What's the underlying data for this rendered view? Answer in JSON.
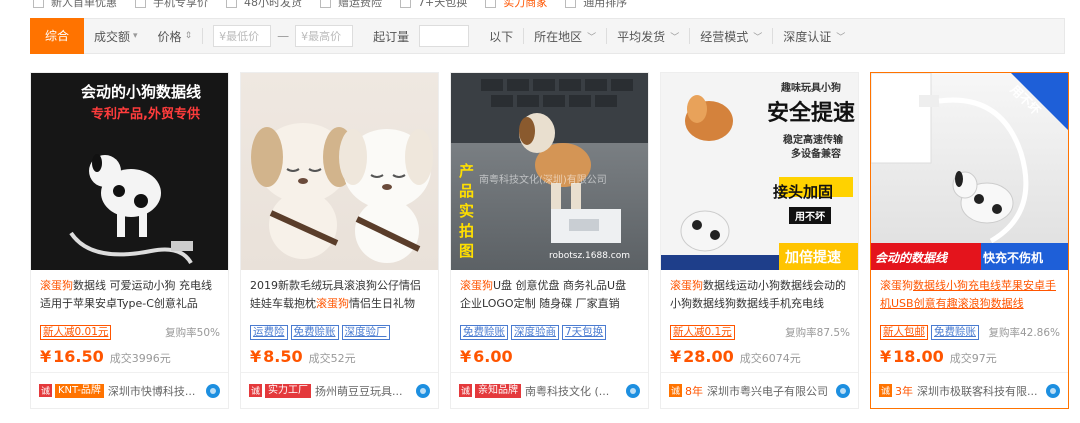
{
  "filters_top": [
    {
      "label": "新人首单优惠",
      "hot": false
    },
    {
      "label": "手机专享价",
      "hot": false
    },
    {
      "label": "48小时发货",
      "hot": false
    },
    {
      "label": "赠运费险",
      "hot": false
    },
    {
      "label": "7+天包换",
      "hot": false
    },
    {
      "label": "实力商家",
      "hot": true
    },
    {
      "label": "通用排序",
      "hot": false
    }
  ],
  "sortbar": {
    "active": "综合",
    "sales": "成交额",
    "price": "价格",
    "min_price_placeholder": "¥最低价",
    "sep": "—",
    "max_price_placeholder": "¥最高价",
    "moq": "起订量",
    "moq_suffix": "以下",
    "region": "所在地区",
    "ship": "平均发货",
    "mode": "经营模式",
    "auth": "深度认证"
  },
  "products": [
    {
      "image": {
        "headline": "会动的小狗数据线",
        "sub": "专利产品,外贸专供"
      },
      "title_kw": "滚蛋狗",
      "title_rest": "数据线 可爱运动小狗 充电线适用于苹果安卓Type-C创意礼品",
      "tags": [
        {
          "label": "新人减0.01元",
          "style": "red"
        }
      ],
      "repurchase": "复购率50%",
      "currency": "¥",
      "price": "16.50",
      "deal": "成交3996元",
      "badge_icon": "诚",
      "badge_label": "KNT-品牌",
      "badge_style": "orange",
      "year": "",
      "seller": "深圳市快博科技..."
    },
    {
      "image": {
        "headline": "",
        "sub": ""
      },
      "title_kw": "滚蛋狗",
      "title_pre": "2019新款毛绒玩具滚浪狗公仔情侣娃娃车载抱枕",
      "title_rest": "情侣生日礼物",
      "tags": [
        {
          "label": "运费险",
          "style": "blue"
        },
        {
          "label": "免费赊账",
          "style": "blue"
        },
        {
          "label": "深度验厂",
          "style": "blue"
        }
      ],
      "repurchase": "",
      "currency": "¥",
      "price": "8.50",
      "deal": "成交52元",
      "badge_icon": "诚",
      "badge_label": "实力工厂",
      "badge_style": "red",
      "year": "",
      "seller": "扬州萌豆豆玩具..."
    },
    {
      "image": {
        "headline": "南粤科技文化(深圳)有限公司",
        "sub": "robotsz.1688.com",
        "side": "产品实拍图"
      },
      "title_kw": "滚蛋狗",
      "title_rest": "U盘 创意优盘 商务礼品U盘 企业LOGO定制 随身碟 厂家直销",
      "tags": [
        {
          "label": "免费赊账",
          "style": "blue"
        },
        {
          "label": "深度验商",
          "style": "blue"
        },
        {
          "label": "7天包换",
          "style": "blue"
        }
      ],
      "repurchase": "",
      "currency": "¥",
      "price": "6.00",
      "deal": "",
      "badge_icon": "诚",
      "badge_label": "亲知品牌",
      "badge_style": "red",
      "year": "",
      "seller": "南粤科技文化 (..."
    },
    {
      "image": {
        "top": "趣味玩具小狗",
        "headline": "安全提速",
        "line1": "稳定高速传输",
        "line2": "多设备兼容",
        "mid": "接头加固",
        "pill": "用不坏",
        "bottom": "加倍提速"
      },
      "title_kw": "滚蛋狗",
      "title_rest": "数据线运动小狗数据线会动的小狗数据线狗数据线手机充电线",
      "tags": [
        {
          "label": "新人减0.1元",
          "style": "red"
        }
      ],
      "repurchase": "复购率87.5%",
      "currency": "¥",
      "price": "28.00",
      "deal": "成交6074元",
      "badge_icon": "诚",
      "badge_label": "",
      "badge_style": "orange",
      "year": "8年",
      "seller": "深圳市粤兴电子有限公司"
    },
    {
      "image": {
        "corner": "用不坏",
        "b1": "会动的数据线",
        "b2": "快充不伤机"
      },
      "title_kw": "滚蛋狗",
      "title_rest": "数据线小狗充电线苹果安卓手机USB创意有趣滚浪狗数据线",
      "tags": [
        {
          "label": "新人包邮",
          "style": "red"
        },
        {
          "label": "免费赊账",
          "style": "blue"
        }
      ],
      "repurchase": "复购率42.86%",
      "currency": "¥",
      "price": "18.00",
      "deal": "成交97元",
      "badge_icon": "诚",
      "badge_label": "",
      "badge_style": "orange",
      "year": "3年",
      "seller": "深圳市极联客科技有限..."
    }
  ]
}
